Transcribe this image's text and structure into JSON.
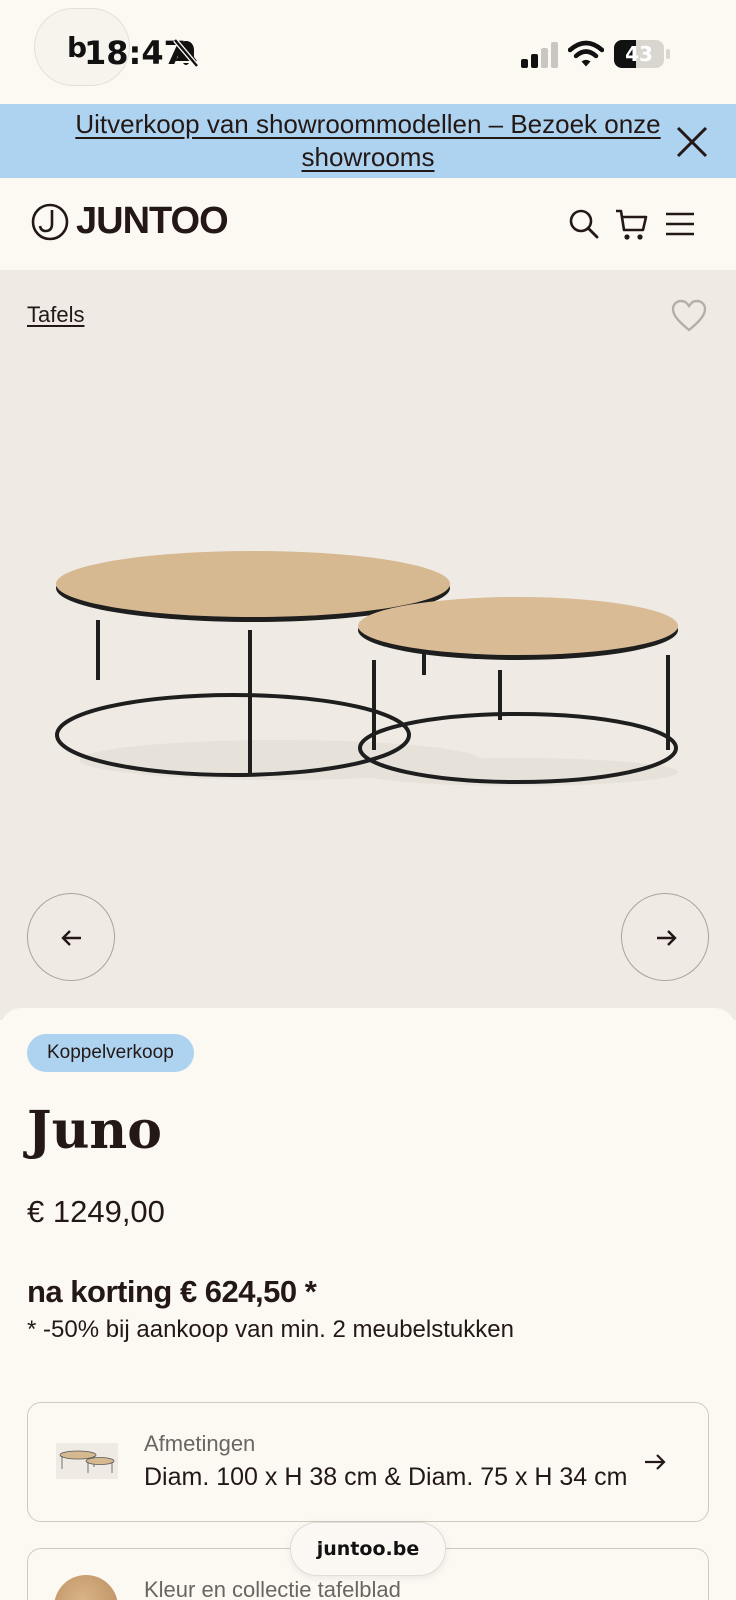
{
  "status_bar": {
    "time": "18:47",
    "bubble_letter": "b",
    "battery": "43",
    "battery_level": 0.43
  },
  "promo": {
    "text": "Uitverkoop van showroommodellen – Bezoek onze showrooms"
  },
  "header": {
    "logo": "JUNTOO",
    "icons": [
      "search-icon",
      "cart-icon",
      "menu-icon"
    ]
  },
  "gallery": {
    "breadcrumb": "Tafels"
  },
  "product": {
    "badge": "Koppelverkoop",
    "title": "Juno",
    "price": "€ 1249,00",
    "discount_price": "na korting € 624,50 *",
    "discount_note": "* -50% bij aankoop van min. 2 meubelstukken"
  },
  "specs": [
    {
      "label": "Afmetingen",
      "value": "Diam. 100 x H 38 cm & Diam. 75 x H 34 cm"
    },
    {
      "label": "Kleur en collectie tafelblad"
    }
  ],
  "browser": {
    "url": "juntoo.be"
  },
  "colors": {
    "background": "#fcf9f3",
    "banner": "#aed3f0",
    "gallery": "#efebe4",
    "text": "#231815"
  }
}
